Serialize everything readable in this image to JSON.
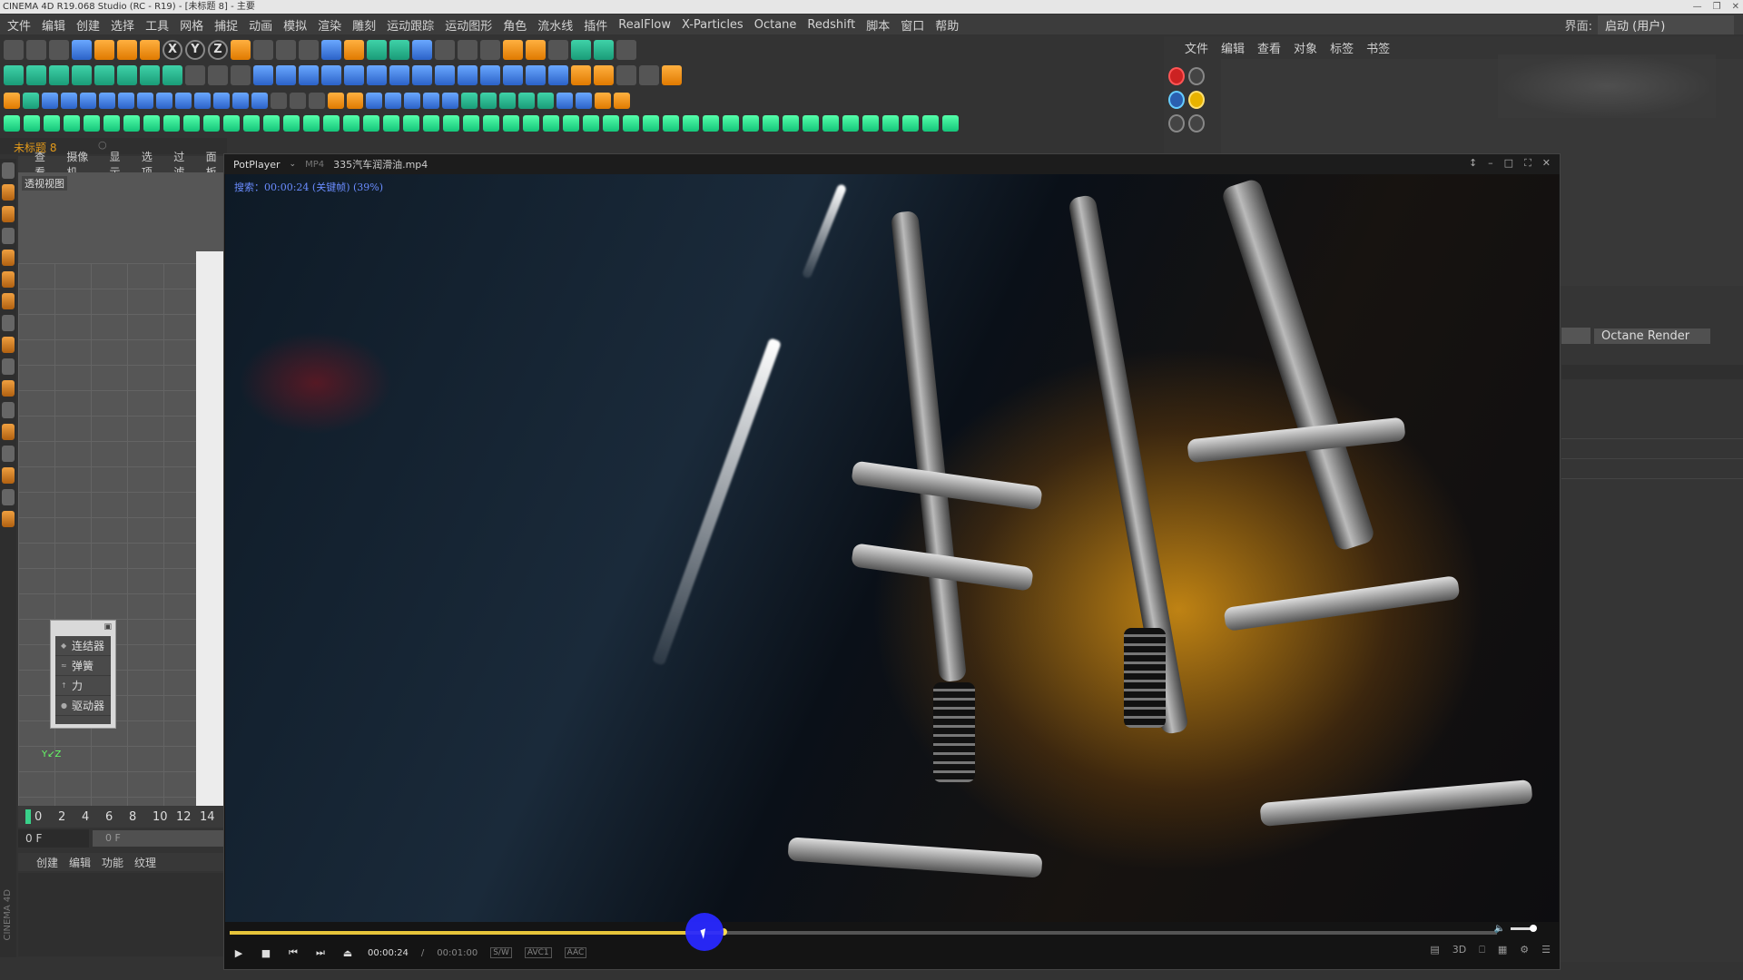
{
  "titlebar": {
    "text": "CINEMA 4D R19.068 Studio (RC - R19) - [未标题 8] - 主要"
  },
  "menu": [
    "文件",
    "编辑",
    "创建",
    "选择",
    "工具",
    "网格",
    "捕捉",
    "动画",
    "模拟",
    "渲染",
    "雕刻",
    "运动跟踪",
    "运动图形",
    "角色",
    "流水线",
    "插件",
    "RealFlow",
    "X-Particles",
    "Octane",
    "Redshift",
    "脚本",
    "窗口",
    "帮助"
  ],
  "layout": {
    "label": "界面:",
    "value": "启动 (用户)"
  },
  "scene_tab": {
    "title": "未标题 8"
  },
  "viewport": {
    "menu": [
      "查看",
      "摄像机",
      "显示",
      "选项",
      "过滤",
      "面板"
    ],
    "label": "透视视图"
  },
  "popup": {
    "items": [
      "连结器",
      "弹簧",
      "力",
      "驱动器"
    ]
  },
  "timeline": {
    "ticks": [
      "0",
      "2",
      "4",
      "6",
      "8",
      "10",
      "12",
      "14"
    ],
    "frame_field": "0 F",
    "slider_text": "0 F"
  },
  "material_menu": [
    "创建",
    "编辑",
    "功能",
    "纹理"
  ],
  "c4d_vertical_logo": "CINEMA 4D",
  "right_panel": {
    "menu": [
      "文件",
      "编辑",
      "查看",
      "对象",
      "标签",
      "书签"
    ],
    "octane_button": "Octane Render"
  },
  "potplayer": {
    "brand": "PotPlayer",
    "format": "MP4",
    "filename": "335汽车润滑油.mp4",
    "seek_overlay": "搜索：00:00:24 (关键帧) (39%)",
    "progress": 0.39,
    "current_time": "00:00:24",
    "duration": "00:01:00",
    "tags": [
      "S/W",
      "AVC1",
      "AAC"
    ],
    "volume": 0.9
  },
  "colors": {
    "accent_orange": "#e39a1a",
    "seek_fill": "#e6c43a",
    "cursor_blue": "#2828ff",
    "timeline_marker": "#39d18a"
  }
}
